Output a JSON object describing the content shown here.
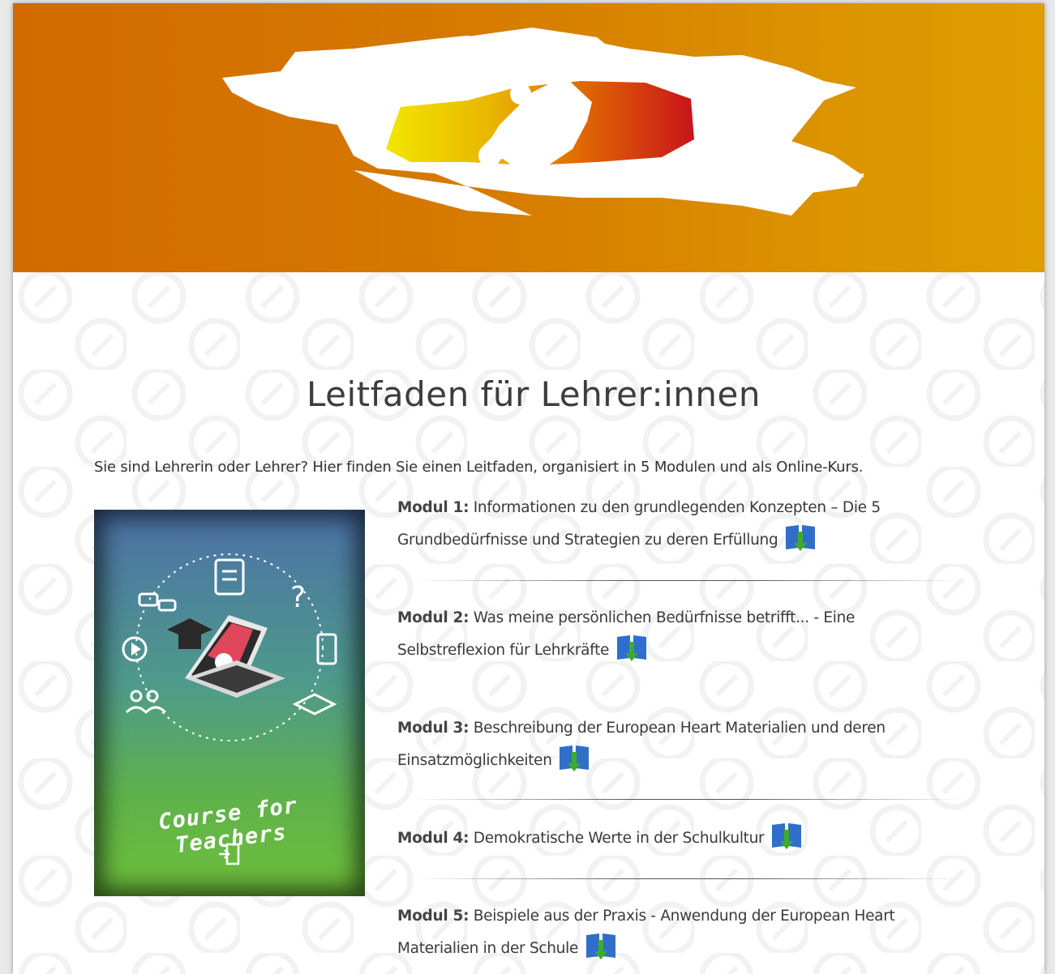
{
  "page": {
    "title": "Leitfaden für Lehrer:innen",
    "intro": "Sie sind Lehrerin oder Lehrer? Hier finden Sie einen Leitfaden, organisiert in 5 Modulen und als Online-Kurs."
  },
  "course_image": {
    "caption": "Course for Teachers"
  },
  "modules": [
    {
      "label": "Modul 1:",
      "text": " Informationen zu den grundlegenden Konzepten – Die 5 Grundbedürfnisse und Strategien zu deren Erfüllung",
      "icon": "book-download-icon"
    },
    {
      "label": "Modul 2:",
      "text": " Was meine persönlichen Bedürfnisse betrifft... - Eine Selbstreflexion für Lehrkräfte",
      "icon": "book-download-icon"
    },
    {
      "label": "Modul 3:",
      "text": " Beschreibung der European Heart Materialien und deren Einsatzmöglichkeiten",
      "icon": "book-download-icon"
    },
    {
      "label": "Modul 4:",
      "text": " Demokratische Werte in der Schulkultur",
      "icon": "book-download-icon"
    },
    {
      "label": "Modul 5:",
      "text": " Beispiele aus der Praxis - Anwendung der European Heart Materialien in der Schule",
      "icon": "book-download-icon"
    }
  ],
  "colors": {
    "banner_start": "#d26a00",
    "banner_end": "#df9e00",
    "text": "#3a3a3a",
    "book_blue": "#2f6fc9",
    "arrow_green": "#3eab2a"
  }
}
